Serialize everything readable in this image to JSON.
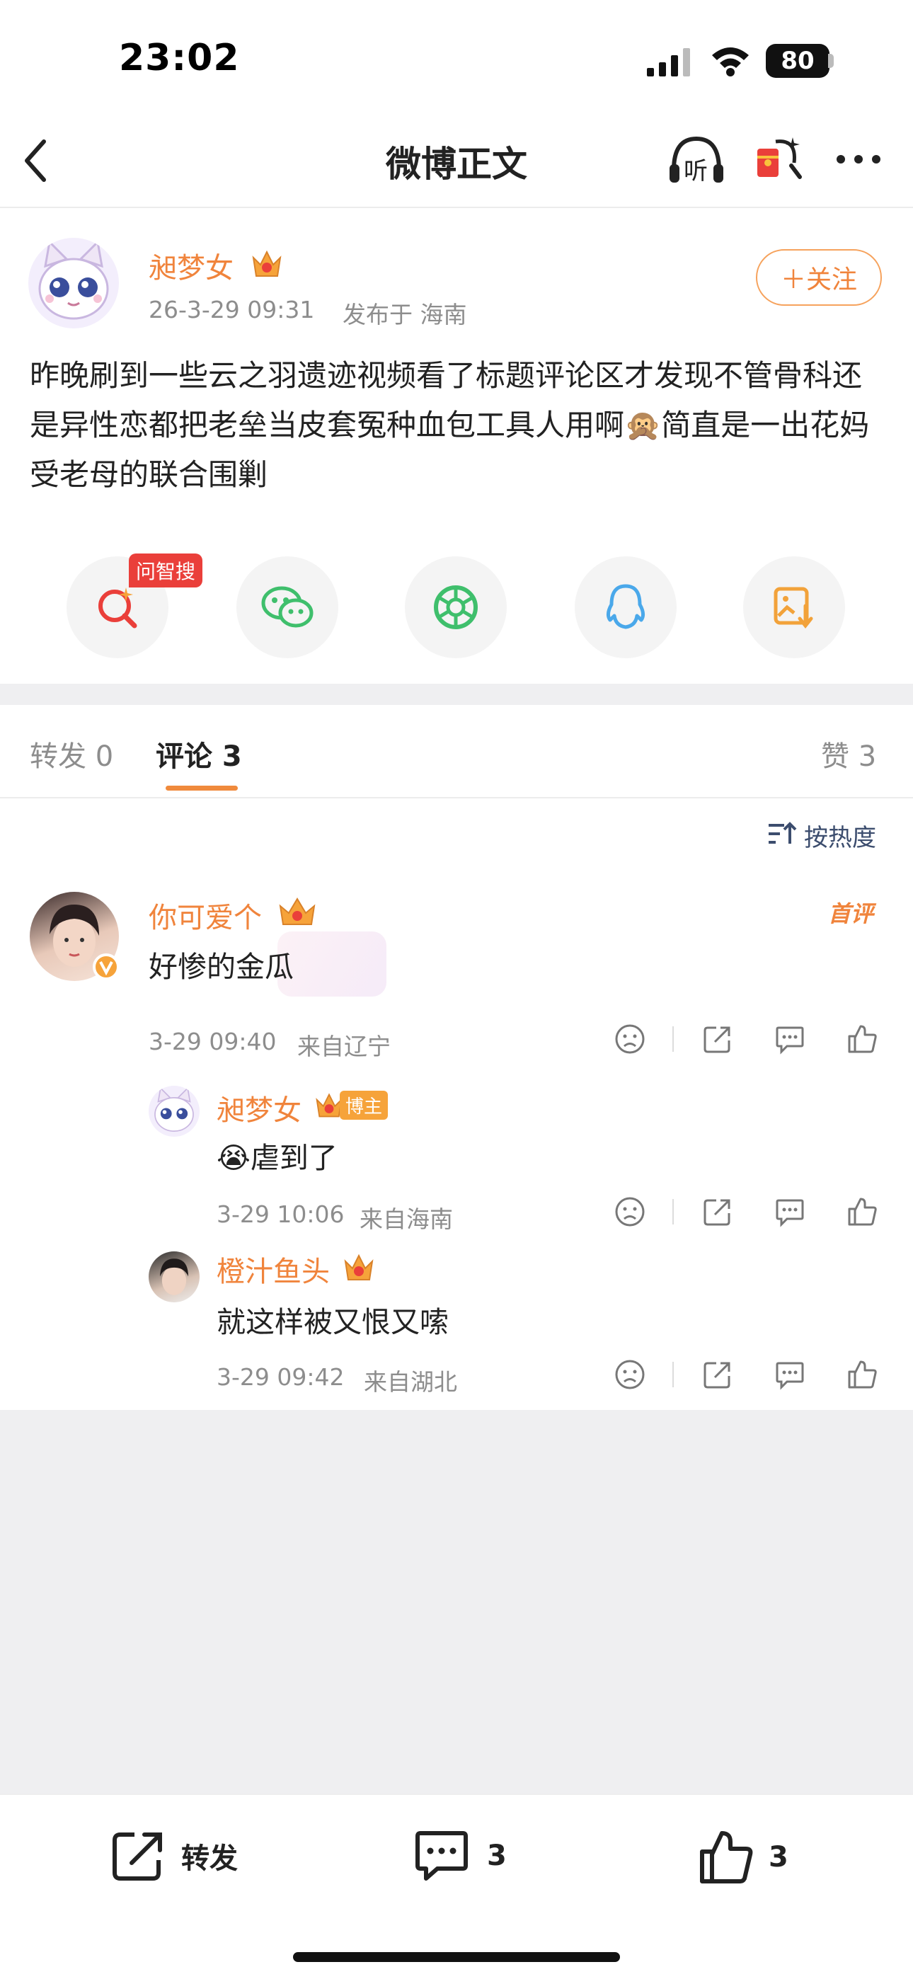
{
  "status_bar": {
    "time": "23:02",
    "battery": "80"
  },
  "nav": {
    "title": "微博正文",
    "listen_label": "听"
  },
  "author": {
    "name": "昶梦女",
    "time": "26-3-29 09:31",
    "location": "发布于 海南",
    "follow_label": "＋关注"
  },
  "post": {
    "text": "昨晚刷到一些云之羽遗迹视频看了标题评论区才发现不管骨科还是异性恋都把老垒当皮套冤种血包工具人用啊🙊简直是一出花妈受老母的联合围剿"
  },
  "share": {
    "hot_badge": "问智搜"
  },
  "tabs": {
    "repost": "转发 0",
    "comment": "评论 3",
    "like": "赞 3"
  },
  "sort_label": "按热度",
  "comments": [
    {
      "name": "你可爱个",
      "badge": "首评",
      "text": "好惨的金瓜",
      "time": "3-29 09:40",
      "location": "来自辽宁"
    }
  ],
  "replies": [
    {
      "name": "昶梦女",
      "badge": "博主",
      "text": "😭虐到了",
      "time": "3-29 10:06",
      "location": "来自海南"
    },
    {
      "name": "橙汁鱼头",
      "text": "就这样被又恨又嗦",
      "time": "3-29 09:42",
      "location": "来自湖北"
    }
  ],
  "bottom_bar": {
    "repost_label": "转发",
    "comment_count": "3",
    "like_count": "3"
  },
  "colors": {
    "accent": "#f0843c",
    "hot": "#ea3f3a",
    "wechat": "#3fbf6c",
    "qq": "#4aa8ea",
    "background": "#efeff1"
  }
}
